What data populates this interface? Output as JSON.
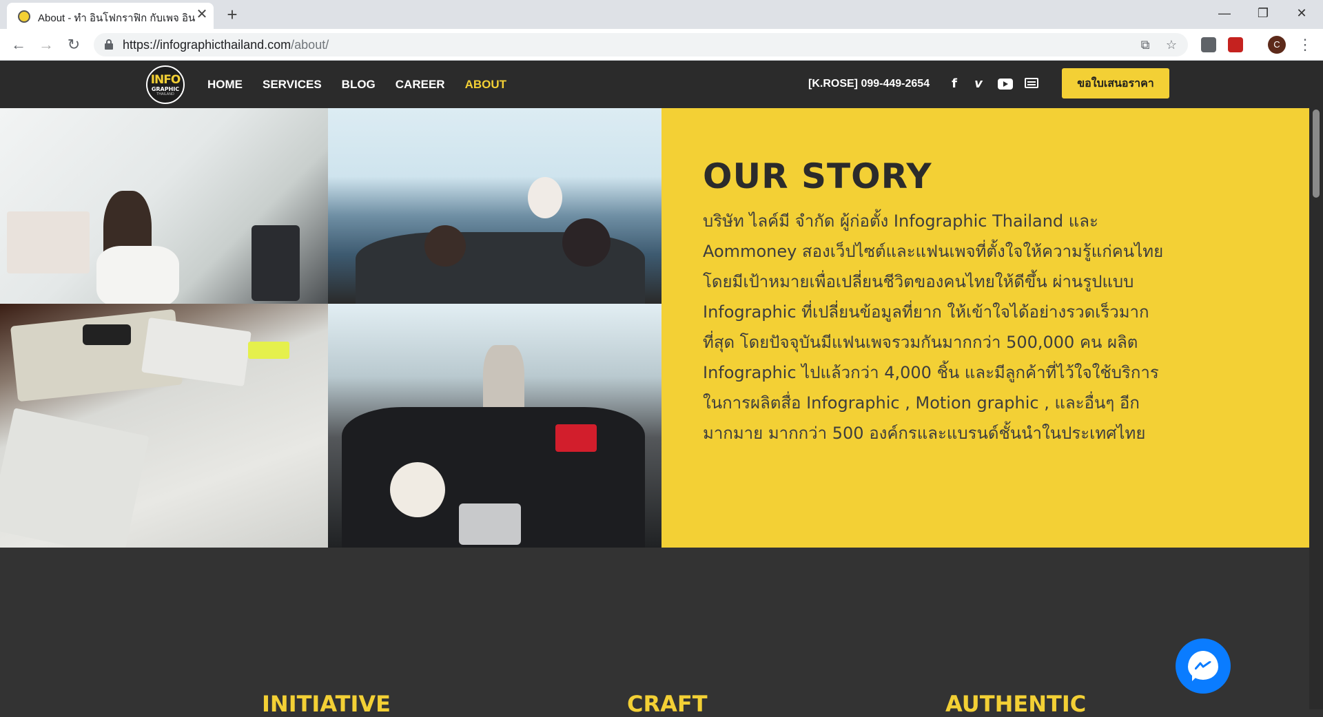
{
  "browser": {
    "tab_title": "About - ทำ อินโฟกราฟิก กับเพจ อินโฟ",
    "tab_close": "✕",
    "new_tab": "+",
    "window_controls": {
      "minimize": "—",
      "maximize": "❐",
      "close": "✕"
    },
    "url_host": "https://infographicthailand.com",
    "url_path": "/about/",
    "profile_initial": "C"
  },
  "site": {
    "logo": {
      "top": "INFO",
      "bottom": "GRAPHIC",
      "tiny": "THAILAND"
    },
    "nav": [
      {
        "label": "HOME",
        "active": false
      },
      {
        "label": "SERVICES",
        "active": false
      },
      {
        "label": "BLOG",
        "active": false
      },
      {
        "label": "CAREER",
        "active": false
      },
      {
        "label": "ABOUT",
        "active": true
      }
    ],
    "phone": "[K.ROSE] 099-449-2654",
    "social": {
      "facebook": "f",
      "vimeo": "v"
    },
    "quote_button": "ขอใบเสนอราคา",
    "colors": {
      "accent": "#f3d035",
      "header_bg": "#2b2b2b",
      "section_bg": "#333333",
      "messenger": "#0a7cff"
    }
  },
  "story": {
    "title": "OUR STORY",
    "body": "บริษัท ไลค์มี จำกัด ผู้ก่อตั้ง Infographic Thailand และ Aommoney สองเว็ปไซต์และแฟนเพจที่ตั้งใจให้ความรู้แก่คนไทย โดยมีเป้าหมายเพื่อเปลี่ยนชีวิตของคนไทยให้ดีขึ้น ผ่านรูปแบบ Infographic ที่เปลี่ยนข้อมูลที่ยาก ให้เข้าใจได้อย่างรวดเร็วมากที่สุด โดยปัจจุบันมีแฟนเพจรวมกันมากกว่า 500,000 คน ผลิต Infographic ไปแล้วกว่า 4,000 ชิ้น และมีลูกค้าที่ไว้ใจใช้บริการในการผลิตสื่อ Infographic , Motion graphic , และอื่นๆ อีกมากมาย มากกว่า 500 องค์กรและแบรนด์ชั้นนำในประเทศไทย"
  },
  "values": [
    {
      "title": "INITIATIVE"
    },
    {
      "title": "CRAFT"
    },
    {
      "title": "AUTHENTIC"
    }
  ]
}
